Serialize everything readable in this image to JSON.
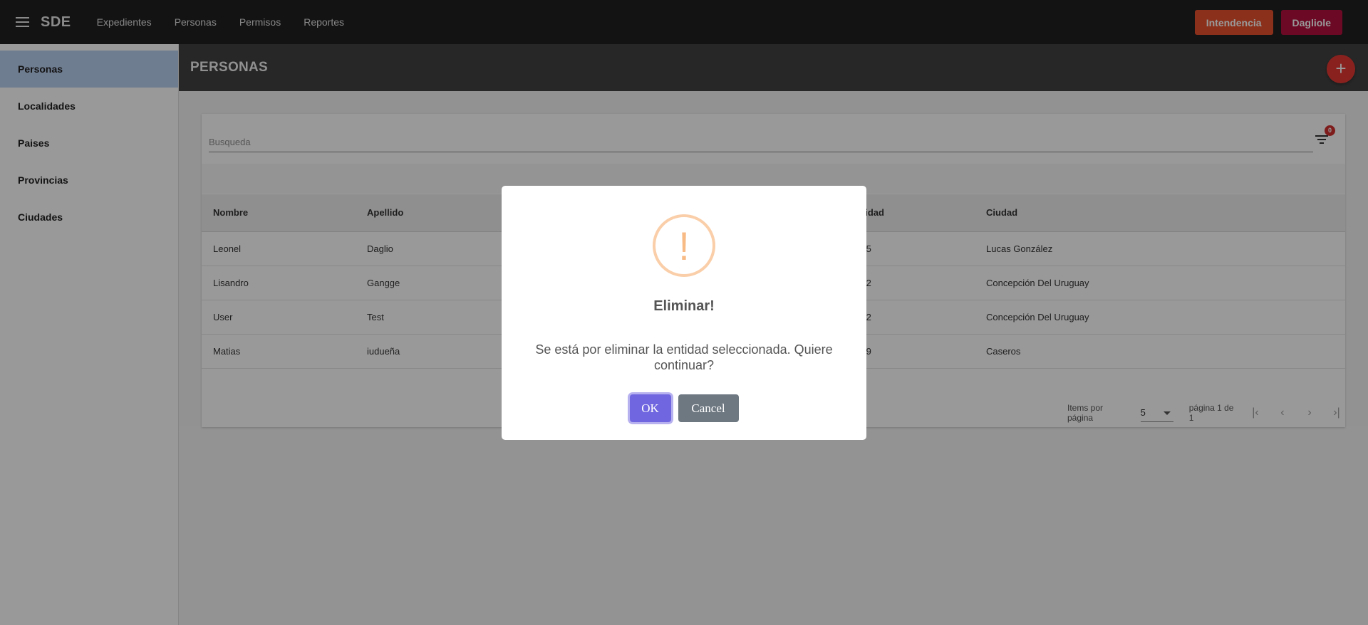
{
  "topbar": {
    "brand": "SDE",
    "nav": [
      "Expedientes",
      "Personas",
      "Permisos",
      "Reportes"
    ],
    "buttons": [
      "Intendencia",
      "Dagliole"
    ]
  },
  "sidebar": {
    "items": [
      "Personas",
      "Localidades",
      "Paises",
      "Provincias",
      "Ciudades"
    ]
  },
  "page": {
    "title": "PERSONAS",
    "add_label": "+"
  },
  "search": {
    "placeholder": "Busqueda",
    "filter_count": "0"
  },
  "table": {
    "columns": [
      "Nombre",
      "Apellido",
      "",
      "",
      "N° Identidad",
      "Ciudad"
    ],
    "rows": [
      [
        "Leonel",
        "Daglio",
        "37547555",
        "Lucas González"
      ],
      [
        "Lisandro",
        "Gangge",
        "24236272",
        "Concepción Del Uruguay"
      ],
      [
        "User",
        "Test",
        "22222222",
        "Concepción Del Uruguay"
      ],
      [
        "Matias",
        "iudueña",
        "34660549",
        "Caseros"
      ]
    ]
  },
  "paginator": {
    "items_label": "Items por página",
    "page_size": "5",
    "range_label": "página 1 de 1"
  },
  "dialog": {
    "icon": "!",
    "title": "Eliminar!",
    "text": "Se está por eliminar la entidad seleccionada. Quiere continuar?",
    "ok_label": "OK",
    "cancel_label": "Cancel"
  }
}
